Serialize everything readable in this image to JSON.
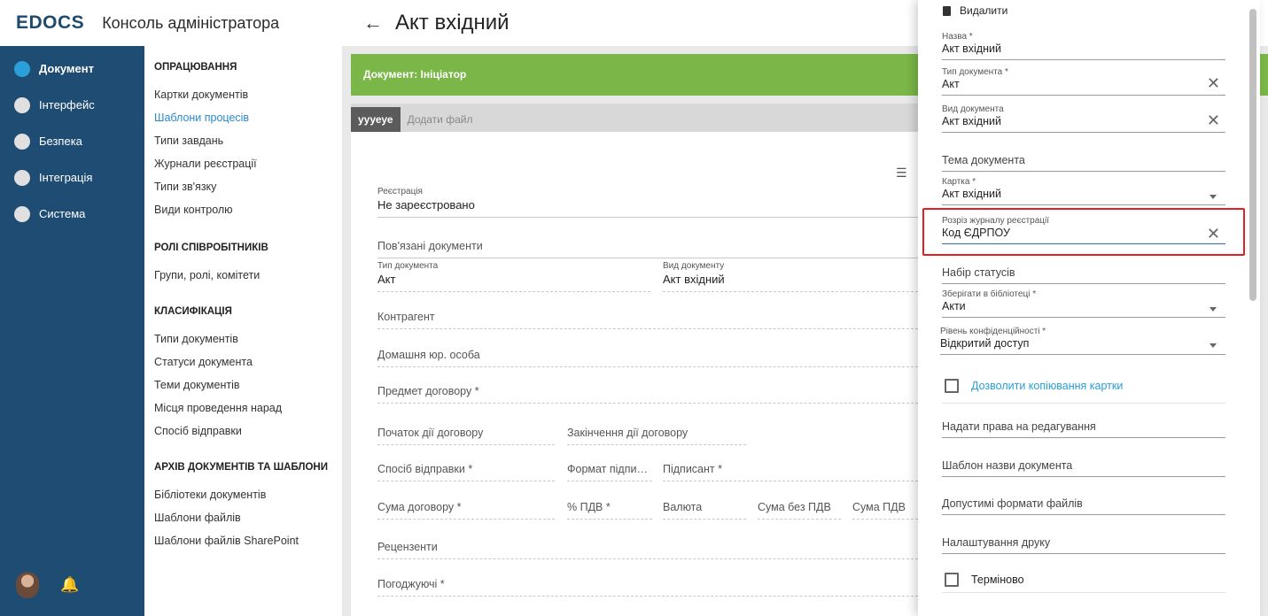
{
  "header": {
    "logo": "EDOCS",
    "app_title": "Консоль адміністратора",
    "page_title": "Акт вхідний"
  },
  "leftnav": [
    {
      "label": "Документ",
      "active": true
    },
    {
      "label": "Інтерфейс",
      "active": false
    },
    {
      "label": "Безпека",
      "active": false
    },
    {
      "label": "Інтеграція",
      "active": false
    },
    {
      "label": "Система",
      "active": false
    }
  ],
  "submenu": {
    "s1_head": "ОПРАЦЮВАННЯ",
    "s1": [
      "Картки документів",
      "Шаблони процесів",
      "Типи завдань",
      "Журнали реєстрації",
      "Типи зв'язку",
      "Види контролю"
    ],
    "s2_head": "РОЛІ СПІВРОБІТНИКІВ",
    "s2": [
      "Групи, ролі, комітети"
    ],
    "s3_head": "КЛАСИФІКАЦІЯ",
    "s3": [
      "Типи документів",
      "Статуси документа",
      "Теми документів",
      "Місця проведення нарад",
      "Спосіб відправки"
    ],
    "s4_head": "АРХІВ ДОКУМЕНТІВ ТА ШАБЛОНИ",
    "s4": [
      "Бібліотеки документів",
      "Шаблони файлів",
      "Шаблони файлів SharePoint"
    ]
  },
  "main": {
    "green_label": "Документ: Ініціатор",
    "tab_active": "уууеуе",
    "tab_add": "Додати файл",
    "reg_cap": "Реєстрація",
    "reg_val": "Не зареєстровано",
    "linked": "Пов'язані документи",
    "doc_type_cap": "Тип документа",
    "doc_type_val": "Акт",
    "doc_kind_cap": "Вид документу",
    "doc_kind_val": "Акт вхідний",
    "counterparty": "Контрагент",
    "home_entity": "Домашня юр. особа",
    "subject": "Предмет договору *",
    "start": "Початок дії договору",
    "end": "Закінчення дії договору",
    "send_method": "Спосіб відправки *",
    "sign_format": "Формат підпи…",
    "signer": "Підписант *",
    "amount": "Сума договору *",
    "vat_pct": "% ПДВ *",
    "currency": "Валюта",
    "sum_no_vat": "Сума без ПДВ",
    "sum_vat": "Сума ПДВ",
    "reviewers": "Рецензенти",
    "approvers": "Погоджуючі *"
  },
  "panel": {
    "delete": "Видалити",
    "name_cap": "Назва *",
    "name_val": "Акт вхідний",
    "type_cap": "Тип документа *",
    "type_val": "Акт",
    "kind_cap": "Вид документа",
    "kind_val": "Акт вхідний",
    "topic": "Тема документа",
    "card_cap": "Картка *",
    "card_val": "Акт вхідний",
    "journal_cap": "Розріз журналу реєстрації",
    "journal_val": "Код ЄДРПОУ",
    "status_set": "Набір статусів",
    "library_cap": "Зберігати в бібліотеці *",
    "library_val": "Акти",
    "conf_cap": "Рівень конфіденційності *",
    "conf_val": "Відкритий доступ",
    "allow_copy": "Дозволити копіювання картки",
    "edit_rights": "Надати права на редагування",
    "name_template": "Шаблон назви документа",
    "file_formats": "Допустимі формати файлів",
    "print_settings": "Налаштування друку",
    "urgent": "Терміново"
  },
  "colors": {
    "nav_bg": "#1f4c73",
    "accent": "#2a9fd8",
    "green": "#7ab648",
    "highlight": "#e02020"
  }
}
